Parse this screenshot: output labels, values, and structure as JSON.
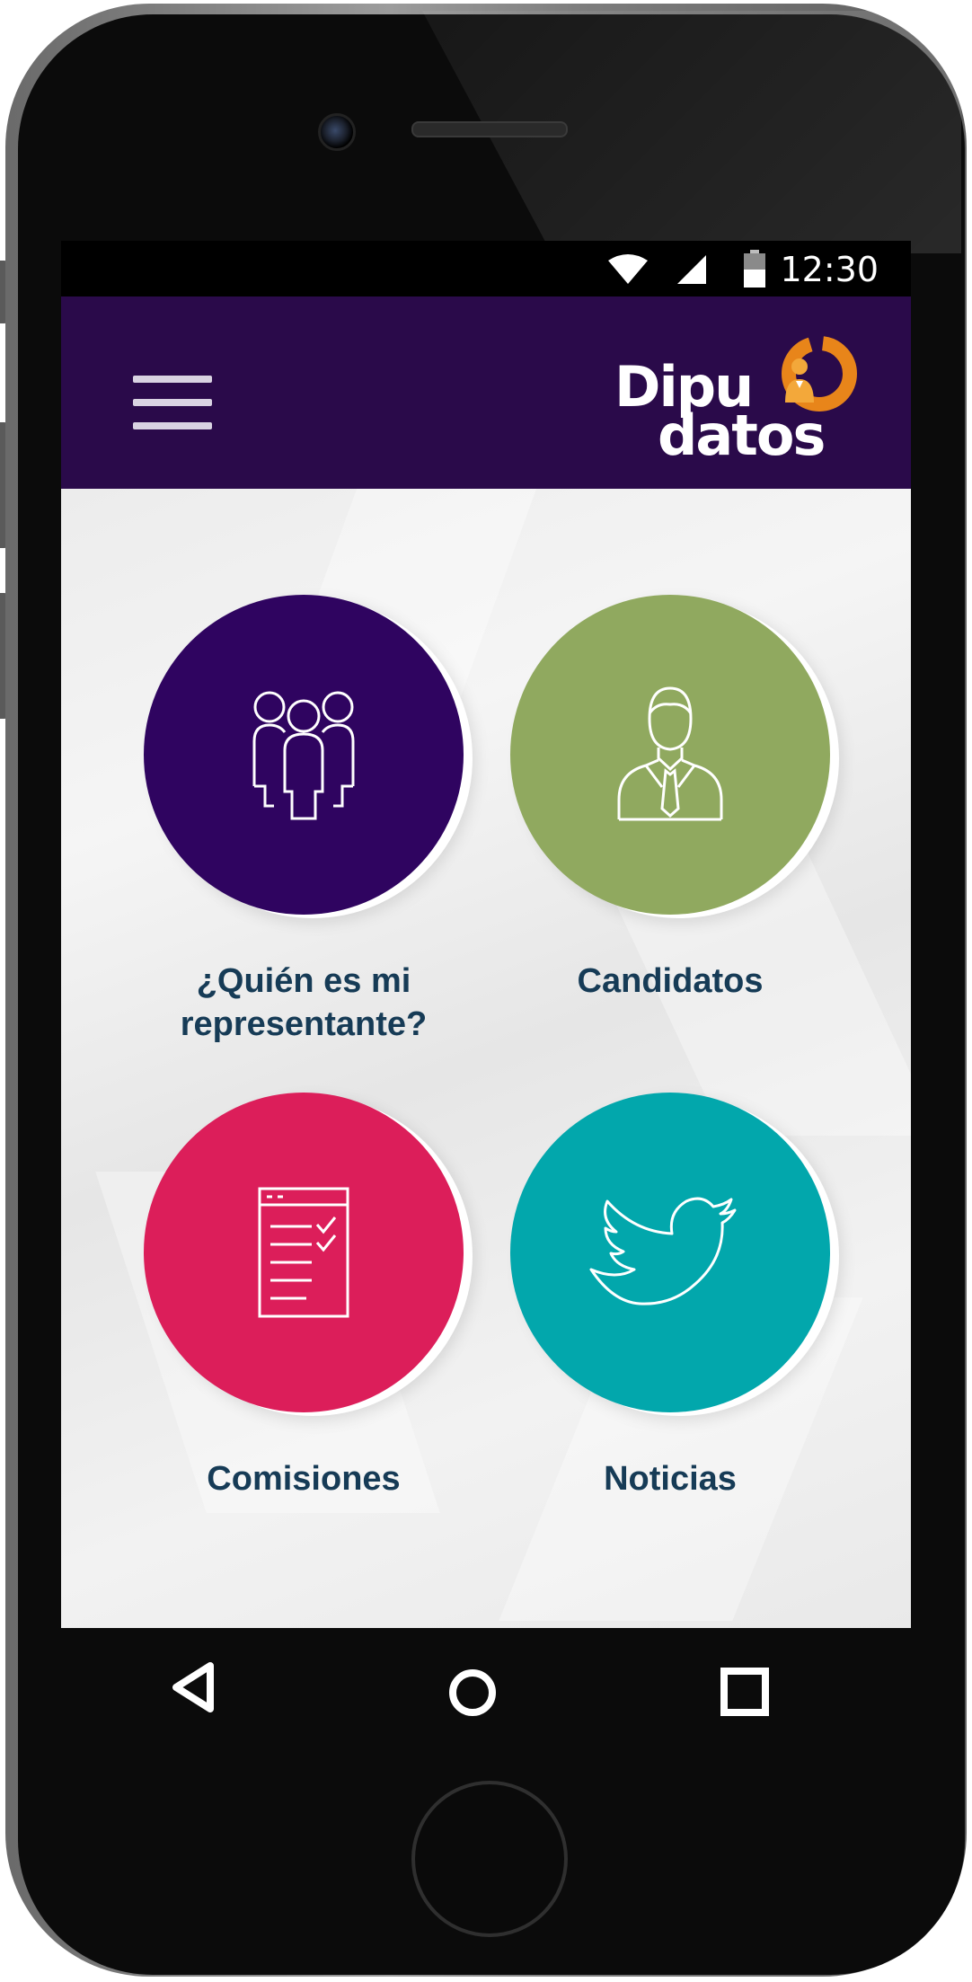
{
  "status_bar": {
    "time": "12:30",
    "icons": [
      "wifi-icon",
      "cell-signal-icon",
      "battery-icon"
    ]
  },
  "app_bar": {
    "menu_icon": "hamburger-menu-icon",
    "logo": {
      "line1": "Dipu",
      "line2": "datos",
      "mark": "orange-ring-person-icon"
    }
  },
  "tiles": [
    {
      "label": "¿Quién es mi representante?",
      "icon": "group-people-icon",
      "color": "#2f0460"
    },
    {
      "label": "Candidatos",
      "icon": "person-suit-icon",
      "color": "#90a95f"
    },
    {
      "label": "Comisiones",
      "icon": "checklist-document-icon",
      "color": "#dc1e5a"
    },
    {
      "label": "Noticias",
      "icon": "twitter-bird-icon",
      "color": "#02a7ac"
    }
  ],
  "nav_bar": {
    "back_icon": "back-triangle-icon",
    "home_icon": "home-circle-icon",
    "recents_icon": "recents-square-icon"
  },
  "colors": {
    "app_bar": "#2a0a4a",
    "label_text": "#163b56",
    "logo_accent": "#e8851a"
  }
}
